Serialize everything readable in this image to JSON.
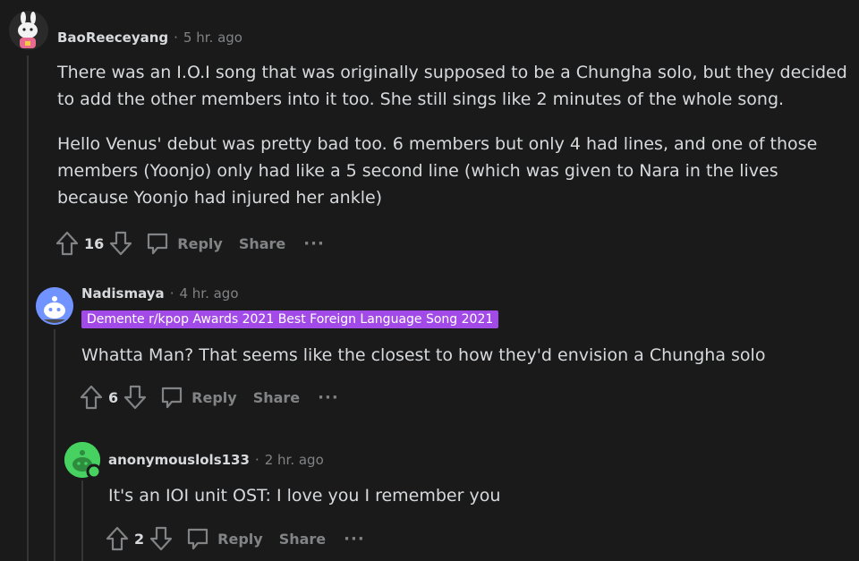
{
  "comments": [
    {
      "username": "BaoReeceyang",
      "time": "5 hr. ago",
      "separator": "·",
      "paragraphs": [
        "There was an I.O.I song that was originally supposed to be a Chungha solo, but they decided to add the other members into it too. She still sings like 2 minutes of the whole song.",
        "Hello Venus' debut was pretty bad too. 6 members but only 4 had lines, and one of those members (Yoonjo) only had like a 5 second line (which was given to Nara in the lives because Yoonjo had injured her ankle)"
      ],
      "score": "16",
      "reply_label": "Reply",
      "share_label": "Share",
      "more_label": "···"
    },
    {
      "username": "Nadismaya",
      "time": "4 hr. ago",
      "separator": "·",
      "flair": "Demente r/kpop Awards 2021 Best Foreign Language Song 2021",
      "paragraphs": [
        "Whatta Man? That seems like the closest to how they'd envision a Chungha solo"
      ],
      "score": "6",
      "reply_label": "Reply",
      "share_label": "Share",
      "more_label": "···"
    },
    {
      "username": "anonymouslols133",
      "time": "2 hr. ago",
      "separator": "·",
      "paragraphs": [
        "It's an IOI unit OST: I love you I remember you"
      ],
      "score": "2",
      "reply_label": "Reply",
      "share_label": "Share",
      "more_label": "···"
    }
  ],
  "colors": {
    "background": "#1a1a1b",
    "text": "#d7dadc",
    "muted": "#818384",
    "flair_bg": "#a24ae8",
    "avatar_blue": "#7193ff",
    "avatar_green": "#46d160"
  },
  "icons": [
    "upvote-icon",
    "downvote-icon",
    "comment-bubble-icon",
    "more-icon",
    "snoo-avatar-icon"
  ]
}
